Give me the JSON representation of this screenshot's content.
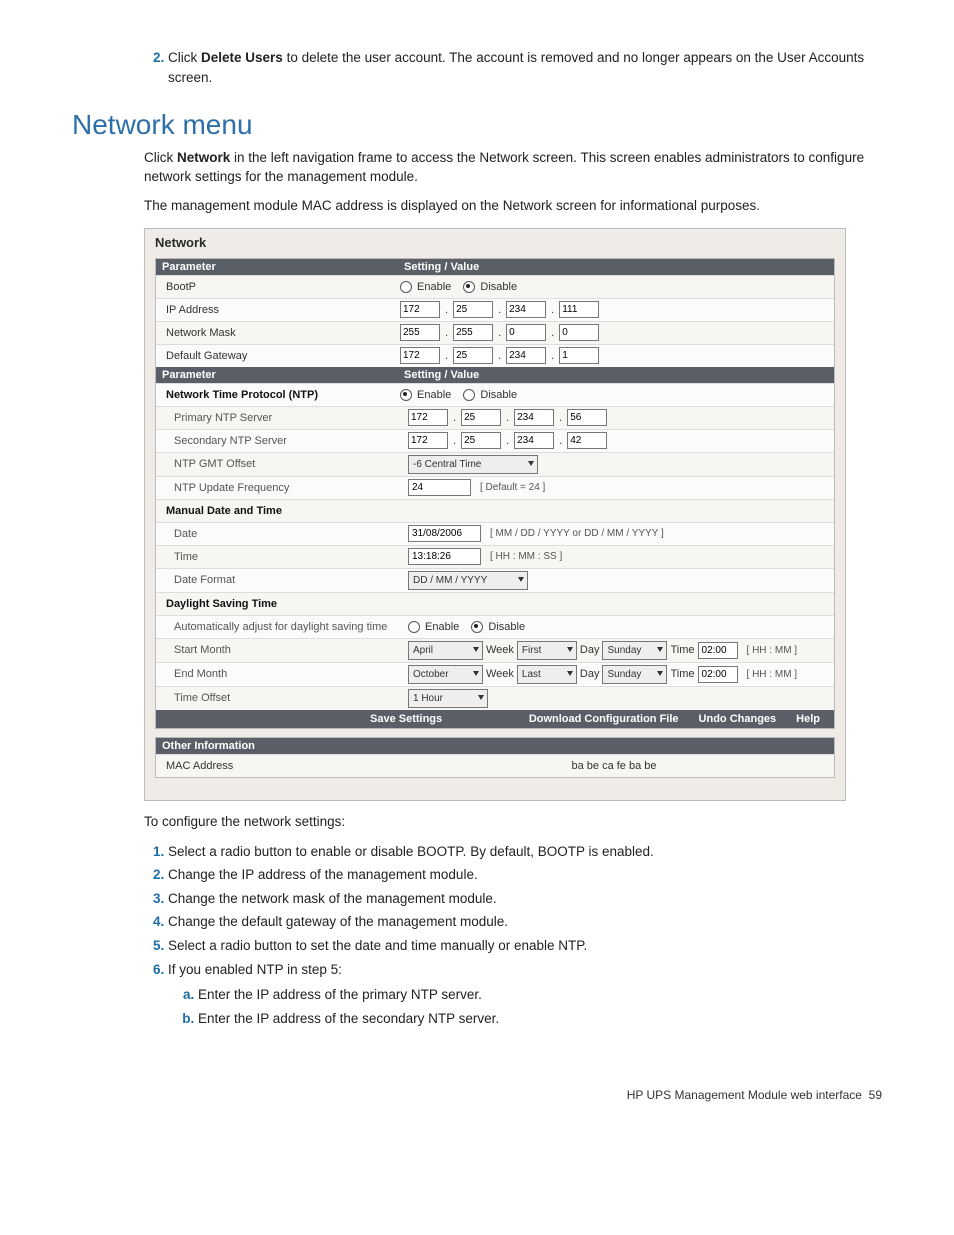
{
  "pre_step": {
    "num": "2.",
    "text_a": "Click ",
    "bold": "Delete Users",
    "text_b": " to delete the user account. The account is removed and no longer appears on the User Accounts screen."
  },
  "heading": "Network menu",
  "intro1_a": "Click ",
  "intro1_bold": "Network",
  "intro1_b": " in the left navigation frame to access the Network screen. This screen enables administrators to configure network settings for the management module.",
  "intro2": "The management module MAC address is displayed on the Network screen for informational purposes.",
  "shot": {
    "title": "Network",
    "hdr_param": "Parameter",
    "hdr_val": "Setting / Value",
    "bootp_label": "BootP",
    "enable": "Enable",
    "disable": "Disable",
    "ip_label": "IP Address",
    "ip": [
      "172",
      "25",
      "234",
      "111"
    ],
    "mask_label": "Network Mask",
    "mask": [
      "255",
      "255",
      "0",
      "0"
    ],
    "gw_label": "Default Gateway",
    "gw": [
      "172",
      "25",
      "234",
      "1"
    ],
    "ntp_label": "Network Time Protocol (NTP)",
    "pntp_label": "Primary NTP Server",
    "pntp": [
      "172",
      "25",
      "234",
      "56"
    ],
    "sntp_label": "Secondary NTP Server",
    "sntp": [
      "172",
      "25",
      "234",
      "42"
    ],
    "gmt_label": "NTP GMT Offset",
    "gmt_val": "-6 Central Time",
    "freq_label": "NTP Update Frequency",
    "freq_val": "24",
    "freq_hint": "[ Default = 24 ]",
    "manual_label": "Manual Date and Time",
    "date_label": "Date",
    "date_val": "31/08/2006",
    "date_hint": "[ MM / DD / YYYY or DD / MM / YYYY ]",
    "time_label": "Time",
    "time_val": "13:18:26",
    "time_hint": "[ HH : MM : SS ]",
    "fmt_label": "Date Format",
    "fmt_val": "DD / MM / YYYY",
    "dst_label": "Daylight Saving Time",
    "auto_label": "Automatically adjust for daylight saving time",
    "start_label": "Start Month",
    "start_month": "April",
    "week_lbl": "Week",
    "start_week": "First",
    "day_lbl": "Day",
    "start_day": "Sunday",
    "time_lbl": "Time",
    "start_time": "02:00",
    "hhmm": "[ HH : MM ]",
    "end_label": "End Month",
    "end_month": "October",
    "end_week": "Last",
    "end_day": "Sunday",
    "end_time": "02:00",
    "off_label": "Time Offset",
    "off_val": "1 Hour",
    "btn_save": "Save Settings",
    "btn_dl": "Download Configuration File",
    "btn_undo": "Undo Changes",
    "btn_help": "Help",
    "other_hdr": "Other Information",
    "mac_label": "MAC Address",
    "mac_val": "ba be ca fe ba be"
  },
  "after_intro": "To configure the network settings:",
  "steps": [
    "Select a radio button to enable or disable BOOTP. By default, BOOTP is enabled.",
    "Change the IP address of the management module.",
    "Change the network mask of the management module.",
    "Change the default gateway of the management module.",
    "Select a radio button to set the date and time manually or enable NTP.",
    "If you enabled NTP in step 5:"
  ],
  "substeps": [
    "Enter the IP address of the primary NTP server.",
    "Enter the IP address of the secondary NTP server."
  ],
  "footer_a": "HP UPS Management Module web interface",
  "footer_b": "59"
}
